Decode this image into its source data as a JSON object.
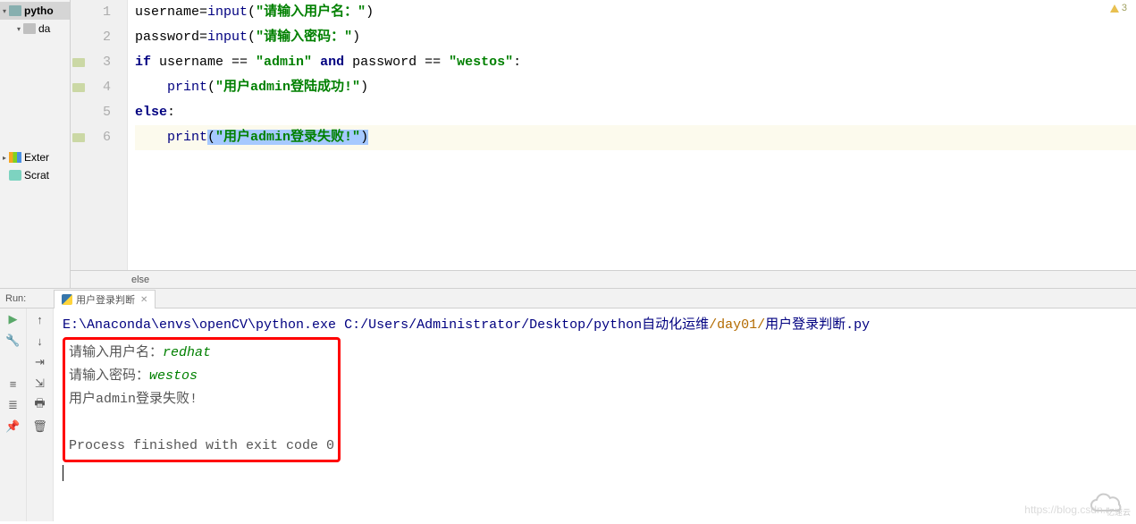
{
  "sidebar": {
    "items": [
      {
        "label": "pytho",
        "indent": 0,
        "sel": true,
        "arrow": "▾",
        "icon": "folder-open"
      },
      {
        "label": "da",
        "indent": 1,
        "arrow": "▾",
        "icon": "folder"
      },
      {
        "label": "Exter",
        "indent": 0,
        "arrow": "▸",
        "icon": "lib",
        "spacer": true
      },
      {
        "label": "Scrat",
        "indent": 0,
        "arrow": "",
        "icon": "scratch"
      }
    ]
  },
  "editor": {
    "warning_count": "3",
    "lines": [
      {
        "n": "1",
        "tokens": [
          [
            "",
            "username"
          ],
          [
            "op",
            "="
          ],
          [
            "fn",
            "input"
          ],
          [
            "op",
            "("
          ],
          [
            "str",
            "\"请输入用户名：\""
          ],
          [
            "op",
            ")"
          ]
        ]
      },
      {
        "n": "2",
        "tokens": [
          [
            "",
            "password"
          ],
          [
            "op",
            "="
          ],
          [
            "fn",
            "input"
          ],
          [
            "op",
            "("
          ],
          [
            "str",
            "\"请输入密码：\""
          ],
          [
            "op",
            ")"
          ]
        ]
      },
      {
        "n": "3",
        "tokens": [
          [
            "kw",
            "if "
          ],
          [
            "",
            "username "
          ],
          [
            "op",
            "== "
          ],
          [
            "str",
            "\"admin\""
          ],
          [
            "kw",
            " and "
          ],
          [
            "",
            "password "
          ],
          [
            "op",
            "== "
          ],
          [
            "str",
            "\"westos\""
          ],
          [
            "op",
            ":"
          ]
        ]
      },
      {
        "n": "4",
        "tokens": [
          [
            "",
            "    "
          ],
          [
            "fn",
            "print"
          ],
          [
            "op",
            "("
          ],
          [
            "str",
            "\"用户admin登陆成功!\""
          ],
          [
            "op",
            ")"
          ]
        ]
      },
      {
        "n": "5",
        "tokens": [
          [
            "kw",
            "else"
          ],
          [
            "op",
            ":"
          ]
        ]
      },
      {
        "n": "6",
        "hl": true,
        "tokens": [
          [
            "",
            "    "
          ],
          [
            "fn",
            "print"
          ],
          [
            "opsel",
            "("
          ],
          [
            "strsel",
            "\"用户admin登录失败!\""
          ],
          [
            "opsel",
            ")"
          ]
        ]
      }
    ],
    "breadcrumb": "else"
  },
  "run": {
    "label": "Run:",
    "tab_title": "用户登录判断",
    "cmd_prefix": "E:\\Anaconda\\envs\\openCV\\python.exe",
    "cmd_path": " C:/Users/Administrator/Desktop/python自动化运维",
    "cmd_folder": "/day01/",
    "cmd_file": "用户登录判断.py",
    "box": {
      "p1a": "请输入用户名：",
      "p1b": "redhat",
      "p2a": "请输入密码：",
      "p2b": "westos",
      "p3": "用户admin登录失败!",
      "exit": "Process finished with exit code 0"
    }
  },
  "watermark": "https://blog.csdn.r",
  "brand": "亿速云"
}
